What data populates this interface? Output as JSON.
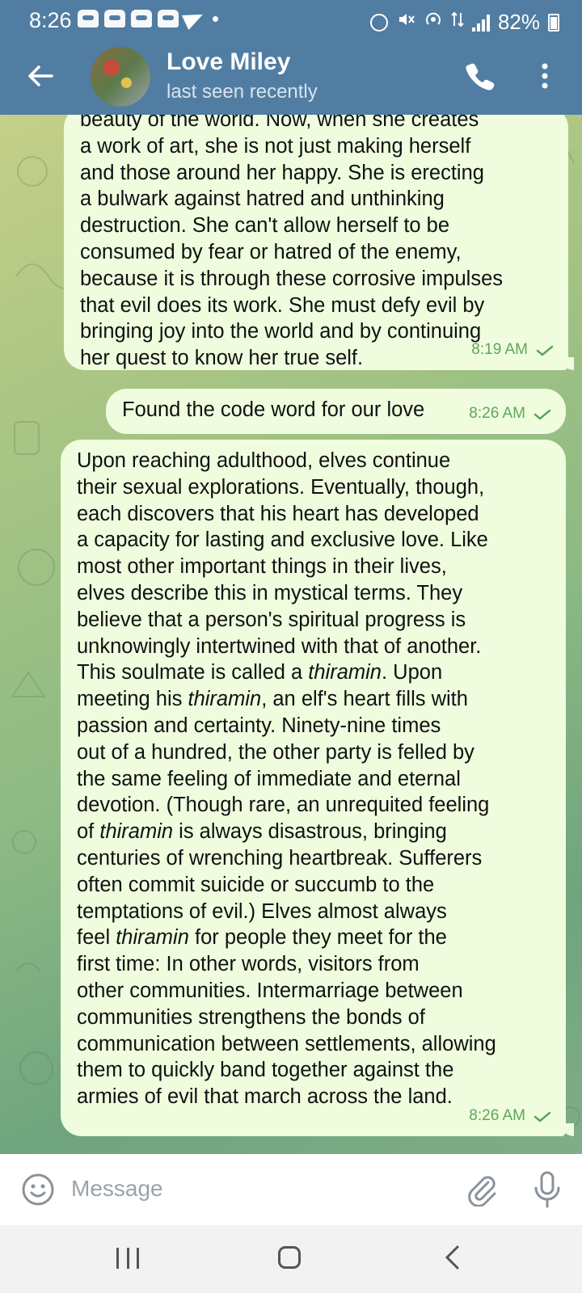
{
  "status_bar": {
    "time": "8:26",
    "battery": "82%",
    "notification_icons": [
      "game-controller-icon",
      "game-controller-icon",
      "game-controller-icon",
      "game-controller-icon",
      "telegram-icon",
      "dot-icon"
    ],
    "system_icons": [
      "alarm-icon",
      "mute-icon",
      "hotspot-icon",
      "data-icon",
      "signal-icon",
      "battery-icon"
    ]
  },
  "header": {
    "name": "Love Miley",
    "status": "last seen recently",
    "color": "#517da2"
  },
  "messages": [
    {
      "type": "outgoing",
      "partial_top": true,
      "text": "beauty of the world. Now, when she creates\na work of art, she is not just making herself\nand those around her happy. She is erecting\na bulwark against hatred and unthinking\ndestruction. She can't allow herself to be\nconsumed by fear or hatred of the enemy,\nbecause it is through these corrosive impulses\nthat evil does its work. She must defy evil by\nbringing joy into the world and by continuing\nher quest to know her true self.",
      "time": "8:19 AM",
      "status": "sent"
    },
    {
      "type": "outgoing",
      "text": "Found the code word for our love",
      "time": "8:26 AM",
      "status": "sent"
    },
    {
      "type": "outgoing",
      "text_parts": [
        "Upon reaching adulthood, elves continue\ntheir sexual explorations. Eventually, though,\neach discovers that his heart has developed\na capacity for lasting and exclusive love. Like\nmost other important things in their lives,\nelves describe this in mystical terms. They\nbelieve that a person's spiritual progress is\nunknowingly intertwined with that of another.\nThis soulmate is called a ",
        "thiramin",
        ". Upon\nmeeting his ",
        "thiramin",
        ", an elf's heart fills with\npassion and certainty. Ninety-nine times\nout of a hundred, the other party is felled by\nthe same feeling of immediate and eternal\ndevotion. (Though rare, an unrequited feeling\nof ",
        "thiramin",
        " is always disastrous, bringing\ncenturies of wrenching heartbreak. Sufferers\noften commit suicide or succumb to the\ntemptations of evil.) Elves almost always\nfeel ",
        "thiramin",
        " for people they meet for the\nfirst time: In other words, visitors from\nother communities. Intermarriage between\ncommunities strengthens the bonds of\ncommunication between settlements, allowing\nthem to quickly band together against the\narmies of evil that march across the land."
      ],
      "time": "8:26 AM",
      "status": "sent"
    }
  ],
  "input": {
    "placeholder": "Message"
  },
  "colors": {
    "bubble_out": "#effdde",
    "timestamp": "#5fa55a",
    "header": "#517da2"
  }
}
